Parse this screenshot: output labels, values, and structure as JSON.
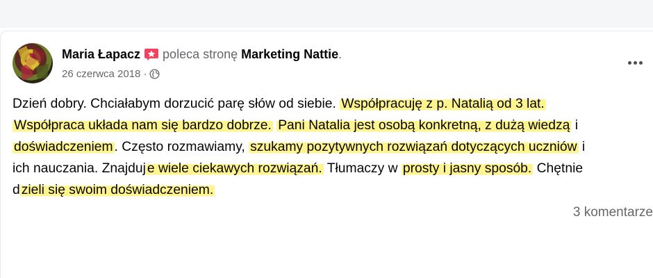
{
  "post": {
    "author": "Maria Łapacz",
    "recommend_text": "poleca stronę",
    "page_name": "Marketing Nattie",
    "page_name_suffix": ".",
    "date": "26 czerwca 2018",
    "date_separator": "·",
    "audience_icon": "globe-icon",
    "more_icon": "more-options-icon",
    "body_lines": [
      [
        {
          "text": "Dzień dobry. Chciałabym dorzucić parę słów od siebie. ",
          "highlight": false
        },
        {
          "text": "Współpracuję z p. Natalią od 3 lat.",
          "highlight": true
        }
      ],
      [
        {
          "text": "Współpraca układa nam się bardzo dobrze.",
          "highlight": true
        },
        {
          "text": " ",
          "highlight": false
        },
        {
          "text": "Pani Natalia jest osobą konkretną, z dużą wiedzą",
          "highlight": true
        },
        {
          "text": " i",
          "highlight": false
        }
      ],
      [
        {
          "text": "doświadczeniem",
          "highlight": true
        },
        {
          "text": ". Często rozmawiamy, ",
          "highlight": false
        },
        {
          "text": "szukamy pozytywnych rozwiązań dotyczących uczniów",
          "highlight": true
        },
        {
          "text": " i",
          "highlight": false
        }
      ],
      [
        {
          "text": "ich nauczania. Znajduj",
          "highlight": false
        },
        {
          "text": "e wiele ciekawych rozwiązań.",
          "highlight": true
        },
        {
          "text": " Tłumaczy w ",
          "highlight": false
        },
        {
          "text": "prosty i jasny sposób.",
          "highlight": true
        },
        {
          "text": " Chętnie",
          "highlight": false
        }
      ],
      [
        {
          "text": "d",
          "highlight": false
        },
        {
          "text": "zieli się swoim doświadczeniem.",
          "highlight": true
        }
      ]
    ],
    "comments_label": "3 komentarze"
  },
  "colors": {
    "highlight": "#FFF16E",
    "secondary_text": "#65676B",
    "recommend_badge": "#F3425F"
  }
}
